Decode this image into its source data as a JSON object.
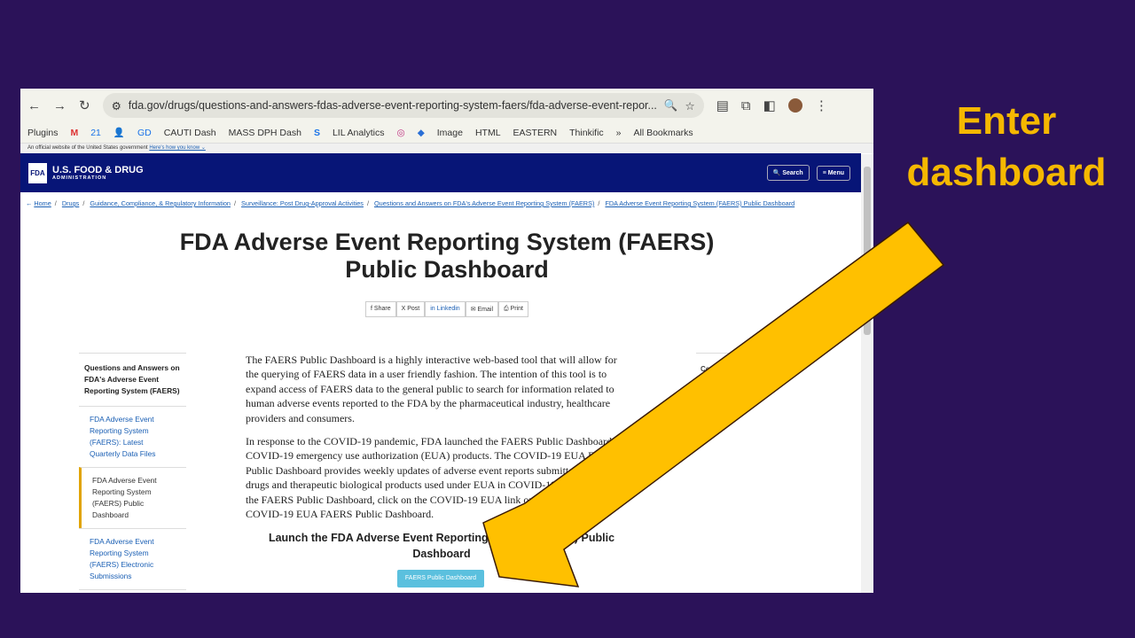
{
  "browser": {
    "url": "fda.gov/drugs/questions-and-answers-fdas-adverse-event-reporting-system-faers/fda-adverse-event-repor...",
    "bookmarks": [
      "Plugins",
      "M",
      "21",
      "👤",
      "GD",
      "CAUTI Dash",
      "MASS DPH Dash",
      "S",
      "LIL Analytics",
      "◎",
      "◆",
      "Image",
      "HTML",
      "EASTERN",
      "Thinkific",
      "»",
      "All Bookmarks"
    ]
  },
  "gov_banner": {
    "text": "An official website of the United States government",
    "link": "Here's how you know ⌄"
  },
  "header": {
    "logo": "FDA",
    "title": "U.S. FOOD & DRUG",
    "subtitle": "ADMINISTRATION",
    "search": "Search",
    "menu": "Menu"
  },
  "breadcrumb": [
    "Home",
    "Drugs",
    "Guidance, Compliance, & Regulatory Information",
    "Surveillance: Post Drug-Approval Activities",
    "Questions and Answers on FDA's Adverse Event Reporting System (FAERS)",
    "FDA Adverse Event Reporting System (FAERS) Public Dashboard"
  ],
  "page": {
    "title_1": "FDA Adverse Event Reporting System (FAERS)",
    "title_2": "Public Dashboard",
    "share": [
      "f Share",
      "X Post",
      "in Linkedin",
      "✉ Email",
      "⎙ Print"
    ],
    "p1": "The FAERS Public Dashboard is a highly interactive web-based tool that will allow for the querying of FAERS data in a user friendly fashion. The intention of this tool is to expand access of FAERS data to the general public to search for information related to human adverse events reported to the FDA by the pharmaceutical industry, healthcare providers and consumers.",
    "p2": "In response to the COVID-19 pandemic, FDA launched the FAERS Public Dashboard for COVID-19 emergency use authorization (EUA) products. The COVID-19 EUA FAERS Public Dashboard provides weekly updates of adverse event reports submitted to FDA for drugs and therapeutic biological products used under EUA in COVID-19. After launching the FAERS Public Dashboard, click on the COVID-19 EUA link on the page to open the COVID-19 EUA FAERS Public Dashboard.",
    "launch": "Launch the FDA Adverse Event Reporting System (FAERS) Public Dashboard",
    "button": "FAERS Public Dashboard",
    "right_heading": "Content current as of:"
  },
  "sidebar": {
    "title": "Questions and Answers on FDA's Adverse Event Reporting System (FAERS)",
    "items": [
      "FDA Adverse Event Reporting System (FAERS): Latest Quarterly Data Files",
      "FDA Adverse Event Reporting System (FAERS) Public Dashboard",
      "FDA Adverse Event Reporting System (FAERS) Electronic Submissions"
    ]
  },
  "annotation": {
    "text": "Enter dashboard",
    "arrow_color": "#ffc000"
  }
}
